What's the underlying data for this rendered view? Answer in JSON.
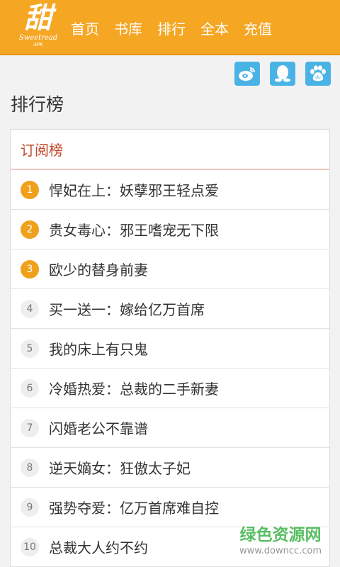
{
  "header": {
    "logo": {
      "glyph": "甜",
      "text": "Sweetread",
      "subtext": "APK"
    },
    "nav": [
      {
        "label": "首页"
      },
      {
        "label": "书库"
      },
      {
        "label": "排行"
      },
      {
        "label": "全本"
      },
      {
        "label": "充值"
      }
    ]
  },
  "share": {
    "icons": [
      "weibo-icon",
      "qq-icon",
      "baidu-icon"
    ],
    "color": "#4ab3e6"
  },
  "page_title": "排行榜",
  "card": {
    "header": "订阅榜",
    "items": [
      {
        "rank": "1",
        "title": "悍妃在上：妖孽邪王轻点爱"
      },
      {
        "rank": "2",
        "title": "贵女毒心：邪王嗜宠无下限"
      },
      {
        "rank": "3",
        "title": "欧少的替身前妻"
      },
      {
        "rank": "4",
        "title": "买一送一：嫁给亿万首席"
      },
      {
        "rank": "5",
        "title": "我的床上有只鬼"
      },
      {
        "rank": "6",
        "title": "冷婚热爱：总裁的二手新妻"
      },
      {
        "rank": "7",
        "title": "闪婚老公不靠谱"
      },
      {
        "rank": "8",
        "title": "逆天嫡女：狂傲太子妃"
      },
      {
        "rank": "9",
        "title": "强势夺爱：亿万首席难自控"
      },
      {
        "rank": "10",
        "title": "总裁大人约不约"
      }
    ]
  },
  "watermark": {
    "title": "绿色资源网",
    "url": "www.downcc.com"
  },
  "colors": {
    "brand": "#f5a623",
    "accent": "#c0462a",
    "top_rank": "#f0a11c"
  }
}
